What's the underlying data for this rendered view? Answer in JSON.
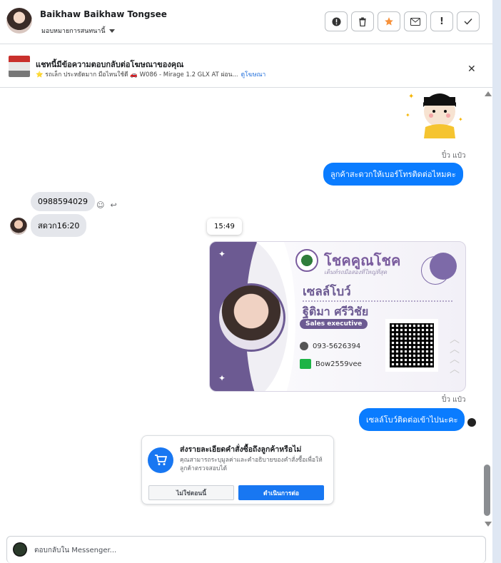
{
  "header": {
    "contact_name": "Baikhaw Baikhaw Tongsee",
    "assign_label": "มอบหมายการสนทนานี้",
    "actions": [
      "report-icon",
      "trash-icon",
      "star-icon",
      "mail-icon",
      "alert-icon",
      "check-icon"
    ]
  },
  "ad": {
    "title": "แชทนี้มีข้อความตอบกลับต่อโฆษณาของคุณ",
    "subtitle": "⭐ รถเล็ก ประหยัดมาก มือไหนใช้ดี 🚗 W086 - Mirage 1.2 GLX AT ผ่อน...",
    "link": "ดูโฆษณา"
  },
  "messages": {
    "seen_1": "ปิ๋ว แป๋ว",
    "out_1": "ลูกค้าสะดวกให้เบอร์โทรติดต่อไหมคะ",
    "in_1": "0988594029",
    "in_2": "สดวก16:20",
    "timestamp": "15:49",
    "seen_2": "ปิ๋ว แป๋ว",
    "out_2": "เซลล์โบว์ติดต่อเข้าไปนะคะ"
  },
  "business_card": {
    "brand": "โชคคูณโชค",
    "brand_sub": "เต็นท์รถมือสองที่ใหญ่ที่สุด",
    "role": "เซลล์โบว์",
    "person": "ฐิติมา ศรีวิชัย",
    "title": "Sales executive",
    "phone": "093-5626394",
    "line_id": "Bow2559vee"
  },
  "order_prompt": {
    "title": "ส่งรายละเอียดคำสั่งซื้อถึงลูกค้าหรือไม่",
    "description": "คุณสามารถระบุมูลค่าและคำอธิบายของคำสั่งซื้อเพื่อให้ลูกค้าตรวจสอบได้",
    "no_label": "ไม่ใช่ตอนนี้",
    "yes_label": "ดำเนินการต่อ"
  },
  "composer": {
    "placeholder": "ตอบกลับใน Messenger..."
  },
  "colors": {
    "accent": "#0a7cff",
    "brand_purple": "#6c5a92"
  }
}
